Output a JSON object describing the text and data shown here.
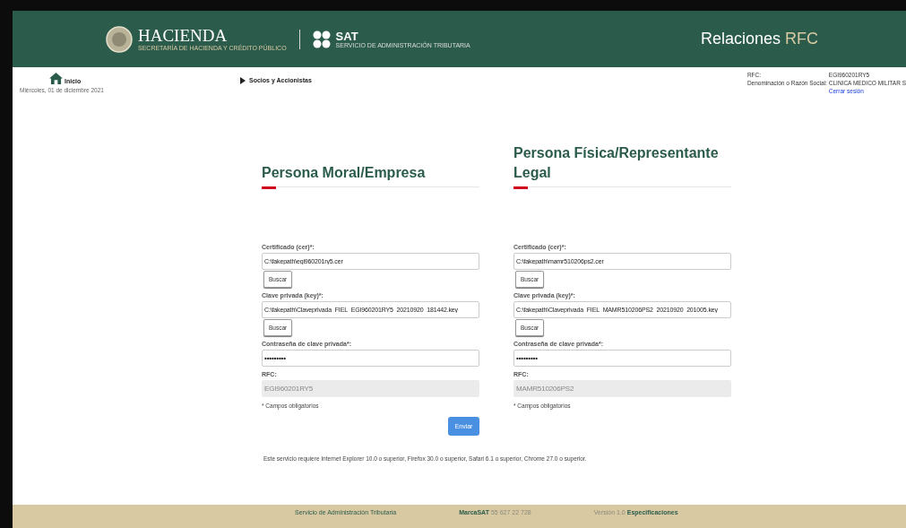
{
  "header": {
    "logo_name": "HACIENDA",
    "logo_subtitle": "SECRETARÍA DE HACIENDA Y CRÉDITO PÚBLICO",
    "sat_name": "SAT",
    "sat_subtitle": "SERVICIO DE ADMINISTRACIÓN TRIBUTARIA",
    "title_main": "Relaciones",
    "title_accent": "RFC"
  },
  "nav": {
    "home": "Inicio",
    "date": "Miércoles, 01 de diciembre 2021",
    "menu_item": "Socios y Accionistas"
  },
  "user": {
    "rfc_label": "RFC:",
    "rfc_value": "EGI960201RY5",
    "name_label": "Denominación o Razón Social:",
    "name_value": "CLINICA MEDICO MILITAR S",
    "logout": "Cerrar sesión"
  },
  "forms": [
    {
      "title": "Persona Moral/Empresa",
      "fields": [
        {
          "kind": "file",
          "label": "Certificado (cer)*:",
          "value": "C:\\fakepath\\egi960201ry5.cer",
          "button": "Buscar"
        },
        {
          "kind": "file",
          "label": "Clave privada (key)*:",
          "value": "C:\\fakepath\\Claveprivada_FIEL_EGI960201RY5_20210920_181442.key",
          "button": "Buscar"
        },
        {
          "kind": "password",
          "label": "Contraseña de clave privada*:",
          "value": "•••••••••"
        },
        {
          "kind": "readonly",
          "label": "RFC:",
          "value": "EGI960201RY5"
        }
      ],
      "note": "* Campos obligatorios",
      "submit": "Enviar"
    },
    {
      "title": "Persona Física/Representante Legal",
      "fields": [
        {
          "kind": "file",
          "label": "Certificado (cer)*:",
          "value": "C:\\fakepath\\mamr510206ps2.cer",
          "button": "Buscar"
        },
        {
          "kind": "file",
          "label": "Clave privada (key)*:",
          "value": "C:\\fakepath\\Claveprivada_FIEL_MAMR510206PS2_20210920_201005.key",
          "button": "Buscar"
        },
        {
          "kind": "password",
          "label": "Contraseña de clave privada*:",
          "value": "•••••••••"
        },
        {
          "kind": "readonly",
          "label": "RFC:",
          "value": "MAMR510206PS2"
        }
      ],
      "note": "* Campos obligatorios"
    }
  ],
  "browser_note": "Este servicio requiere Internet Explorer 10.0 o superior, Firefox 30.0 o superior, Safari 6.1 o superior, Chrome 27.0 o superior.",
  "footer": {
    "org": "Servicio de Administración Tributaria",
    "brand": "MarcaSAT",
    "phone": "55 627 22 728",
    "version": "Versión 1.0",
    "spec_link": "Especificaciones"
  }
}
